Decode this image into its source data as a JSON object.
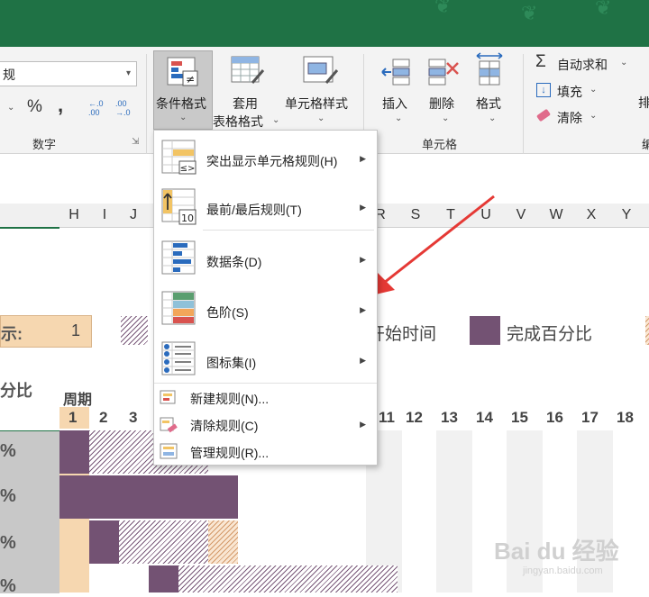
{
  "ribbon": {
    "number_format_value": "规",
    "percent_symbol": "%",
    "comma_symbol": ",",
    "increase_decimal": "←.0\n.00",
    "decrease_decimal": ".00\n→.0",
    "number_group_label": "数字",
    "conditional_format_label": "条件格式",
    "table_format_line1": "套用",
    "table_format_line2": "表格格式",
    "cell_style_label": "单元格样式",
    "insert_label": "插入",
    "delete_label": "删除",
    "format_label": "格式",
    "cells_group_label": "单元格",
    "autosum_label": "自动求和",
    "fill_label": "填充",
    "clear_label": "清除",
    "edge_text_1": "排",
    "edge_text_2": "编"
  },
  "columns": [
    "H",
    "I",
    "J",
    "R",
    "S",
    "T",
    "U",
    "V",
    "W",
    "X",
    "Y"
  ],
  "sheet": {
    "highlight_label": "示:",
    "highlight_value": "1",
    "legend_start": "开始时间",
    "legend_complete": "完成百分比",
    "left_label": "分比",
    "period_label": "周期",
    "period_numbers": [
      "1",
      "2",
      "3",
      "11",
      "12",
      "13",
      "14",
      "15",
      "16",
      "17",
      "18"
    ],
    "pct_symbol": "%"
  },
  "menu": {
    "items": [
      {
        "label": "突出显示单元格规则(H)"
      },
      {
        "label": "最前/最后规则(T)"
      },
      {
        "label": "数据条(D)"
      },
      {
        "label": "色阶(S)"
      },
      {
        "label": "图标集(I)"
      }
    ],
    "small_items": [
      {
        "label": "新建规则(N)..."
      },
      {
        "label": "清除规则(C)"
      },
      {
        "label": "管理规则(R)..."
      }
    ]
  },
  "watermark": {
    "brand": "Bai du 经验",
    "url": "jingyan.baidu.com"
  },
  "colors": {
    "excel_green": "#1f7245",
    "gantt_purple": "#735273",
    "peach": "#f6d7b0",
    "arrow_red": "#e53935"
  }
}
